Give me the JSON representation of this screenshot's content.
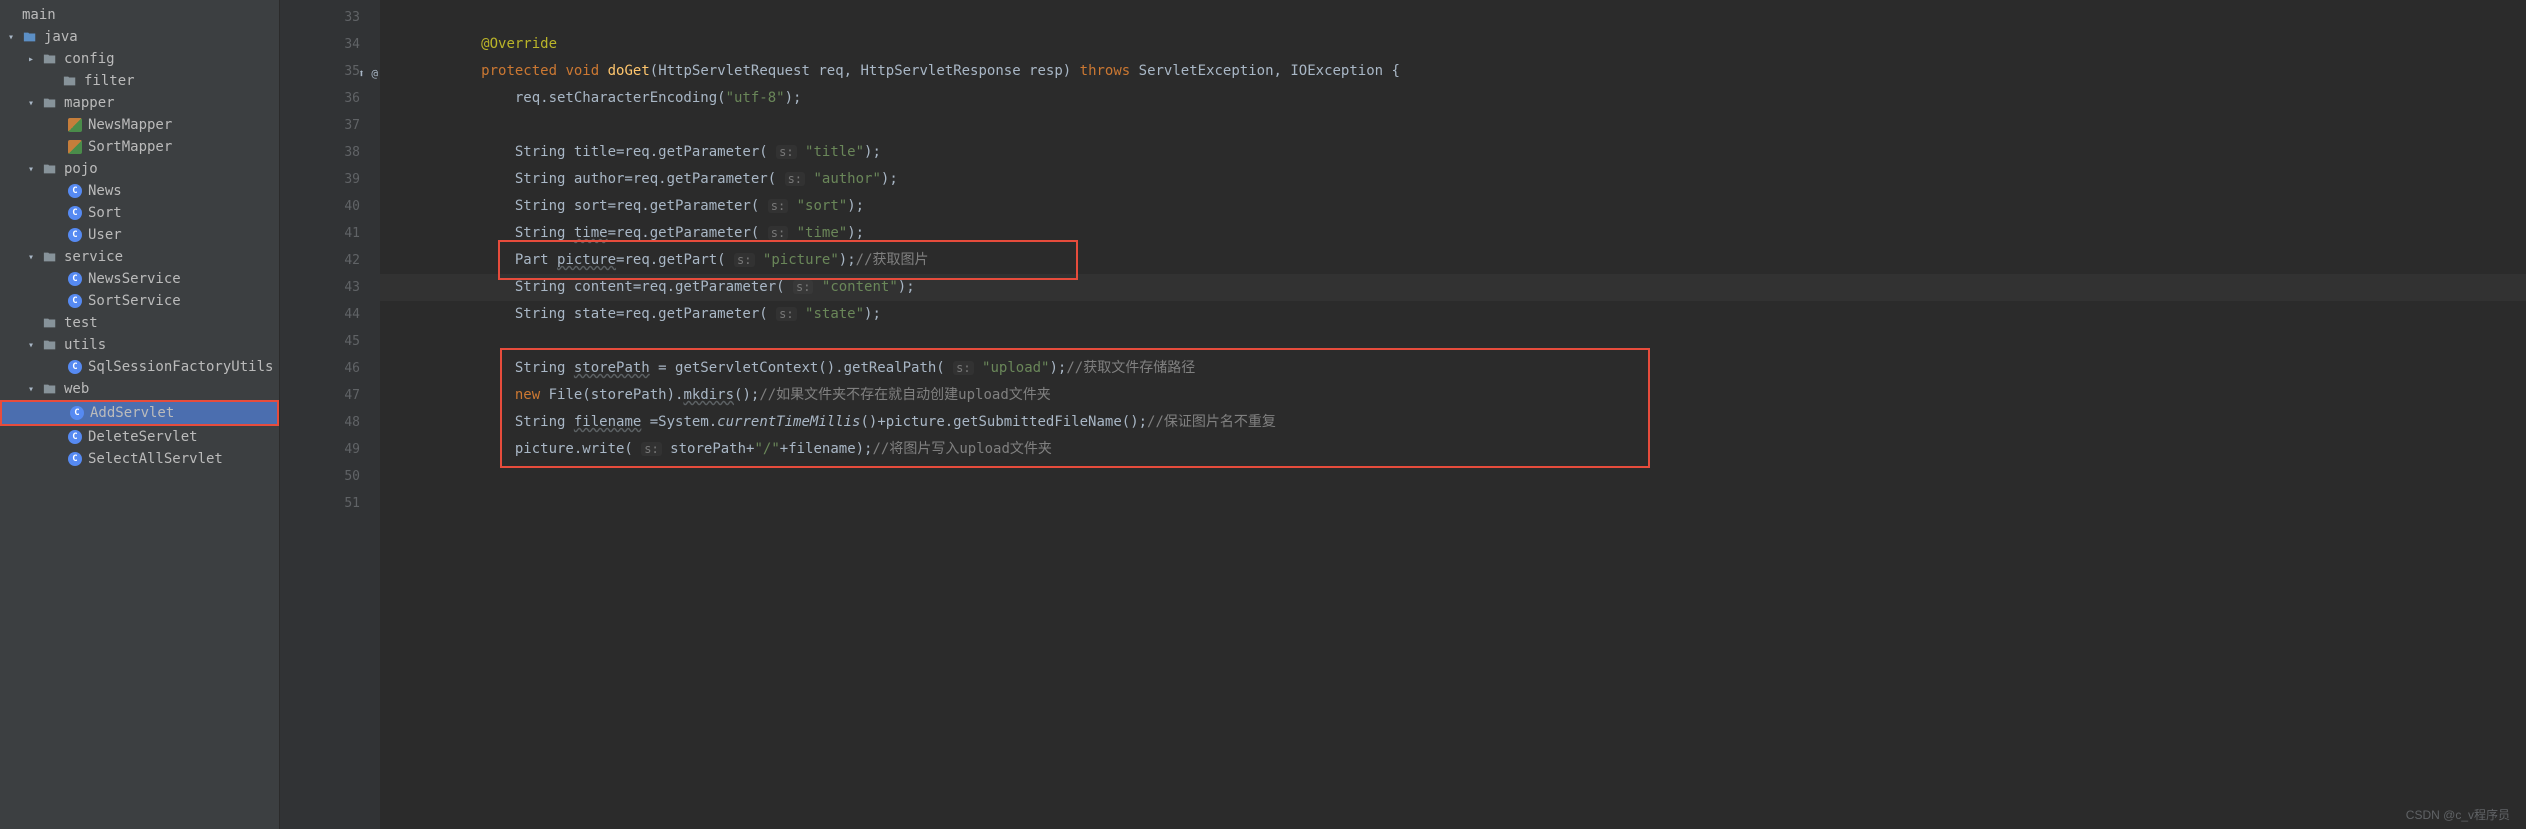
{
  "tree": {
    "root": "main",
    "java": "java",
    "config": "config",
    "filter": "filter",
    "mapper": "mapper",
    "newsMapper": "NewsMapper",
    "sortMapper": "SortMapper",
    "pojo": "pojo",
    "news": "News",
    "sort": "Sort",
    "user": "User",
    "service": "service",
    "newsService": "NewsService",
    "sortService": "SortService",
    "test": "test",
    "utils": "utils",
    "sqlSessionFactoryUtils": "SqlSessionFactoryUtils",
    "web": "web",
    "addServlet": "AddServlet",
    "deleteServlet": "DeleteServlet",
    "selectAllServlet": "SelectAllServlet"
  },
  "gutter": {
    "l33": "33",
    "l34": "34",
    "l35": "35",
    "l36": "36",
    "l37": "37",
    "l38": "38",
    "l39": "39",
    "l40": "40",
    "l41": "41",
    "l42": "42",
    "l43": "43",
    "l44": "44",
    "l45": "45",
    "l46": "46",
    "l47": "47",
    "l48": "48",
    "l49": "49",
    "l50": "50",
    "l51": "51",
    "mark35": "⬆ @"
  },
  "code": {
    "l34": "@Override",
    "l35": {
      "protected": "protected",
      "void": "void",
      "doGet": "doGet",
      "params": "(HttpServletRequest req, HttpServletResponse resp) ",
      "throws": "throws",
      "rest": " ServletException, IOException {"
    },
    "l36": {
      "a": "req.setCharacterEncoding(",
      "s": "\"utf-8\"",
      "b": ");"
    },
    "l38": {
      "a": "String title=req.getParameter( ",
      "h": "s:",
      "s": " \"title\"",
      "b": ");"
    },
    "l39": {
      "a": "String author=req.getParameter( ",
      "h": "s:",
      "s": " \"author\"",
      "b": ");"
    },
    "l40": {
      "a": "String sort=req.getParameter( ",
      "h": "s:",
      "s": " \"sort\"",
      "b": ");"
    },
    "l41": {
      "a": "String ",
      "u": "time",
      "a2": "=req.getParameter( ",
      "h": "s:",
      "s": " \"time\"",
      "b": ");"
    },
    "l42": {
      "a": "Part ",
      "u": "picture",
      "a2": "=req.getPart( ",
      "h": "s:",
      "s": " \"picture\"",
      "b": ");",
      "c": "//获取图片"
    },
    "l43": {
      "a": "String content=req.getParameter( ",
      "h": "s:",
      "s": " \"content\"",
      "b": ");"
    },
    "l44": {
      "a": "String state=req.getParameter( ",
      "h": "s:",
      "s": " \"state\"",
      "b": ");"
    },
    "l46": {
      "a": "String ",
      "u": "storePath",
      "a2": " = getServletContext().getRealPath( ",
      "h": "s:",
      "s": " \"upload\"",
      "b": ");",
      "c": "//获取文件存储路径"
    },
    "l47": {
      "new": "new",
      "a": " File(storePath).",
      "m": "mkdirs",
      "b": "();",
      "c": "//如果文件夹不存在就自动创建upload文件夹"
    },
    "l48": {
      "a": "String ",
      "u": "filename",
      "a2": " =System.",
      "m": "currentTimeMillis",
      "a3": "()+picture.getSubmittedFileName();",
      "c": "//保证图片名不重复"
    },
    "l49": {
      "a": "picture.write( ",
      "h": "s:",
      "a2": " storePath+",
      "s": "\"/\"",
      "a3": "+filename);",
      "c": "//将图片写入upload文件夹"
    }
  },
  "watermark": "CSDN @c_v程序员"
}
